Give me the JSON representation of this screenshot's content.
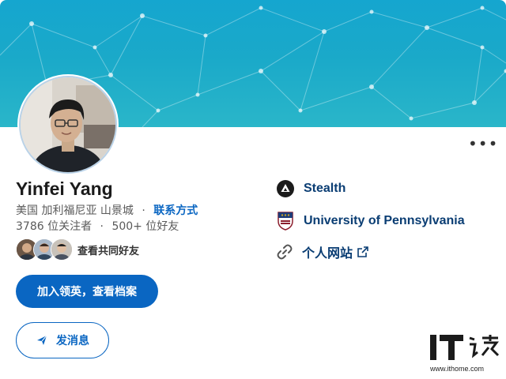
{
  "profile": {
    "name": "Yinfei Yang",
    "location": "美国 加利福尼亚 山景城",
    "separator": "·",
    "contact_link": "联系方式",
    "followers": "3786 位关注者",
    "dot": "·",
    "connections": "500+ 位好友",
    "mutual_label": "查看共同好友"
  },
  "actions": {
    "join_label": "加入领英，查看档案",
    "message_label": "发消息",
    "more_label": "•••"
  },
  "experience": {
    "company": "Stealth",
    "school": "University of Pennsylvania",
    "website": "个人网站"
  },
  "watermark": {
    "logo_text": "IT",
    "url": "www.ithome.com"
  },
  "colors": {
    "accent": "#0a66c2",
    "banner": "#1aa9c9"
  }
}
